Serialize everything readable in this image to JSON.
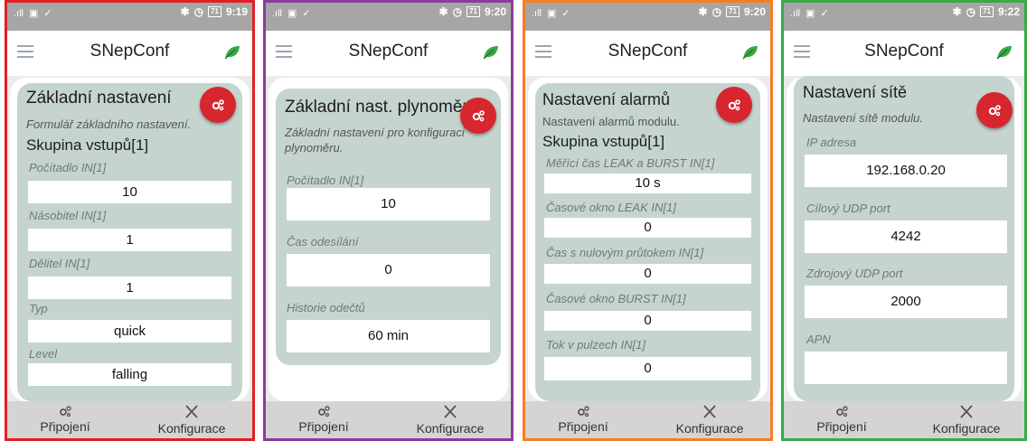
{
  "app_title": "SNepConf",
  "colors": {
    "frame_1": "#e21f26",
    "frame_2": "#8b3c9a",
    "frame_3": "#f57e20",
    "frame_4": "#39a94a",
    "accent": "#d7262e",
    "card": "#c5d4ce"
  },
  "nav": {
    "connect": "Připojení",
    "config": "Konfigurace"
  },
  "screens": [
    {
      "time": "9:19",
      "battery": "71",
      "title": "Základní nastavení",
      "desc": "Formulář základního nastavení.",
      "group": "Skupina vstupů[1]",
      "fields": [
        {
          "label": "Počítadlo IN[1]",
          "value": "10"
        },
        {
          "label": "Násobitel IN[1]",
          "value": "1"
        },
        {
          "label": "Dělitel IN[1]",
          "value": "1"
        },
        {
          "label": "Typ",
          "value": "quick"
        },
        {
          "label": "Level",
          "value": "falling"
        }
      ]
    },
    {
      "time": "9:20",
      "battery": "71",
      "title": "Základní nast. plynoměru",
      "desc": "Základní nastavení pro konfiguraci plynoměru.",
      "fields": [
        {
          "label": "Počítadlo IN[1]",
          "value": "10"
        },
        {
          "label": "Čas odesílání",
          "value": "0"
        },
        {
          "label": "Historie odečtů",
          "value": "60 min"
        }
      ]
    },
    {
      "time": "9:20",
      "battery": "71",
      "title": "Nastavení alarmů",
      "desc": "Nastavení alarmů modulu.",
      "group": "Skupina vstupů[1]",
      "fields": [
        {
          "label": "Měřící čas LEAK a BURST IN[1]",
          "value": "10 s"
        },
        {
          "label": "Časové okno LEAK IN[1]",
          "value": "0"
        },
        {
          "label": "Čas s nulovým průtokem IN[1]",
          "value": "0"
        },
        {
          "label": "Časové okno BURST IN[1]",
          "value": "0"
        },
        {
          "label": "Tok v pulzech IN[1]",
          "value": "0"
        }
      ]
    },
    {
      "time": "9:22",
      "battery": "71",
      "title": "Nastavení sítě",
      "desc": "Nastavení sítě modulu.",
      "fields": [
        {
          "label": "IP adresa",
          "value": "192.168.0.20"
        },
        {
          "label": "Cílový UDP port",
          "value": "4242"
        },
        {
          "label": "Zdrojový UDP port",
          "value": "2000"
        },
        {
          "label": "APN",
          "value": ""
        }
      ]
    }
  ]
}
